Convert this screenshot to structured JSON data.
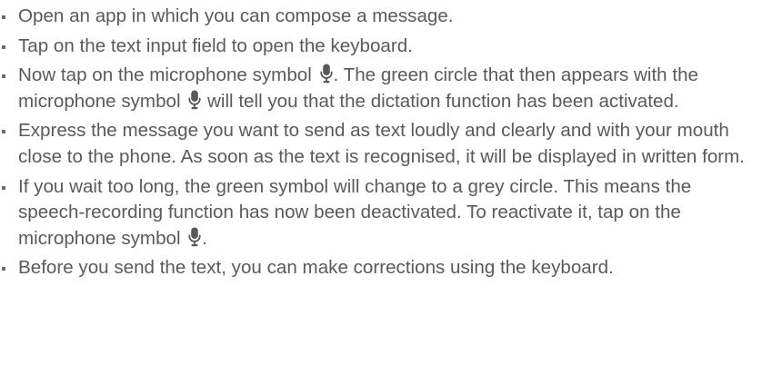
{
  "steps": [
    {
      "text_before": "Open an app in which you can compose a message.",
      "text_middle": "",
      "text_after": ""
    },
    {
      "text_before": "Tap on the text input field to open the keyboard.",
      "text_middle": "",
      "text_after": ""
    },
    {
      "text_before": "Now tap on the microphone symbol",
      "text_middle": ". The green circle that then appears with the microphone symbol",
      "text_after": " will tell you that the dictation function has been activated."
    },
    {
      "text_before": "Express the message you want to send as text loudly and clearly and with your mouth close to the phone. As soon as the text is recognised, it will be displayed in written form.",
      "text_middle": "",
      "text_after": ""
    },
    {
      "text_before": "If you wait too long, the green symbol will change to a grey circle. This means the speech-recording function has now been deactivated. To reactivate it, tap on the microphone symbol",
      "text_middle": ".",
      "text_after": ""
    },
    {
      "text_before": "Before you send the text, you can make corrections using the keyboard.",
      "text_middle": "",
      "text_after": ""
    }
  ],
  "icons": {
    "microphone": "microphone-icon"
  },
  "colors": {
    "text": "#5a5a5a",
    "icon": "#595959"
  }
}
